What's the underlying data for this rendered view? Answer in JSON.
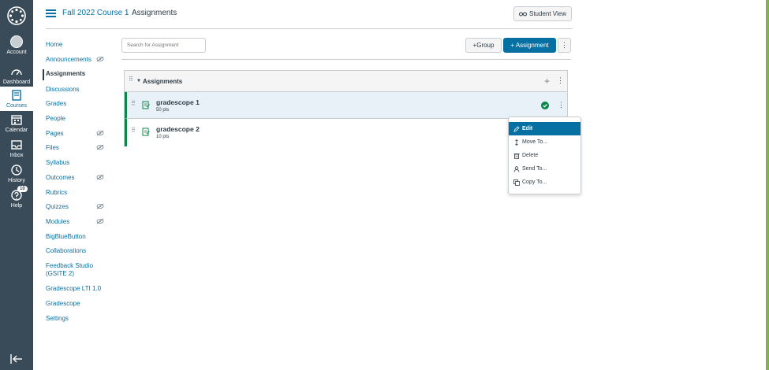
{
  "global_nav": {
    "items": [
      {
        "label": "Account",
        "icon": "account-avatar"
      },
      {
        "label": "Dashboard",
        "icon": "dashboard-icon"
      },
      {
        "label": "Courses",
        "icon": "courses-icon"
      },
      {
        "label": "Calendar",
        "icon": "calendar-icon"
      },
      {
        "label": "Inbox",
        "icon": "inbox-icon"
      },
      {
        "label": "History",
        "icon": "history-icon"
      },
      {
        "label": "Help",
        "icon": "help-icon",
        "badge": "10"
      }
    ],
    "active": "Courses"
  },
  "header": {
    "course": "Fall 2022 Course 1",
    "separator": "›",
    "current": "Assignments",
    "student_view": "Student View"
  },
  "course_nav": {
    "items": [
      {
        "label": "Home"
      },
      {
        "label": "Announcements"
      },
      {
        "label": "Assignments"
      },
      {
        "label": "Discussions"
      },
      {
        "label": "Grades"
      },
      {
        "label": "People"
      },
      {
        "label": "Pages"
      },
      {
        "label": "Files"
      },
      {
        "label": "Syllabus"
      },
      {
        "label": "Outcomes"
      },
      {
        "label": "Rubrics"
      },
      {
        "label": "Quizzes"
      },
      {
        "label": "Modules"
      },
      {
        "label": "BigBlueButton"
      },
      {
        "label": "Collaborations"
      },
      {
        "label": "Feedback Studio (GSITE 2)"
      },
      {
        "label": "Gradescope LTI 1.0"
      },
      {
        "label": "Gradescope"
      },
      {
        "label": "Settings"
      }
    ],
    "active": "Assignments",
    "hidden_items": [
      "Announcements",
      "Pages",
      "Files",
      "Outcomes",
      "Quizzes",
      "Modules"
    ]
  },
  "toolbar": {
    "search_placeholder": "Search for Assignment",
    "group_label": "+Group",
    "assignment_label": "+ Assignment",
    "more_label": "⋮"
  },
  "assignment_group": {
    "title": "Assignments",
    "add_label": "+",
    "menu_label": "⋮",
    "assignments": [
      {
        "title": "gradescope 1",
        "points": "50 pts",
        "published": true
      },
      {
        "title": "gradescope 2",
        "points": "10 pts",
        "published": false
      }
    ]
  },
  "dropdown": {
    "items": [
      {
        "label": "Edit",
        "icon": "pencil-icon"
      },
      {
        "label": "Move To...",
        "icon": "move-icon"
      },
      {
        "label": "Delete",
        "icon": "trash-icon"
      },
      {
        "label": "Send To...",
        "icon": "user-icon"
      },
      {
        "label": "Copy To...",
        "icon": "copy-icon"
      }
    ],
    "active": "Edit"
  },
  "colors": {
    "nav_bg": "#394b58",
    "brand_blue": "#0770a3",
    "published_green": "#0b874b",
    "edge_green": "#7fb24c"
  }
}
